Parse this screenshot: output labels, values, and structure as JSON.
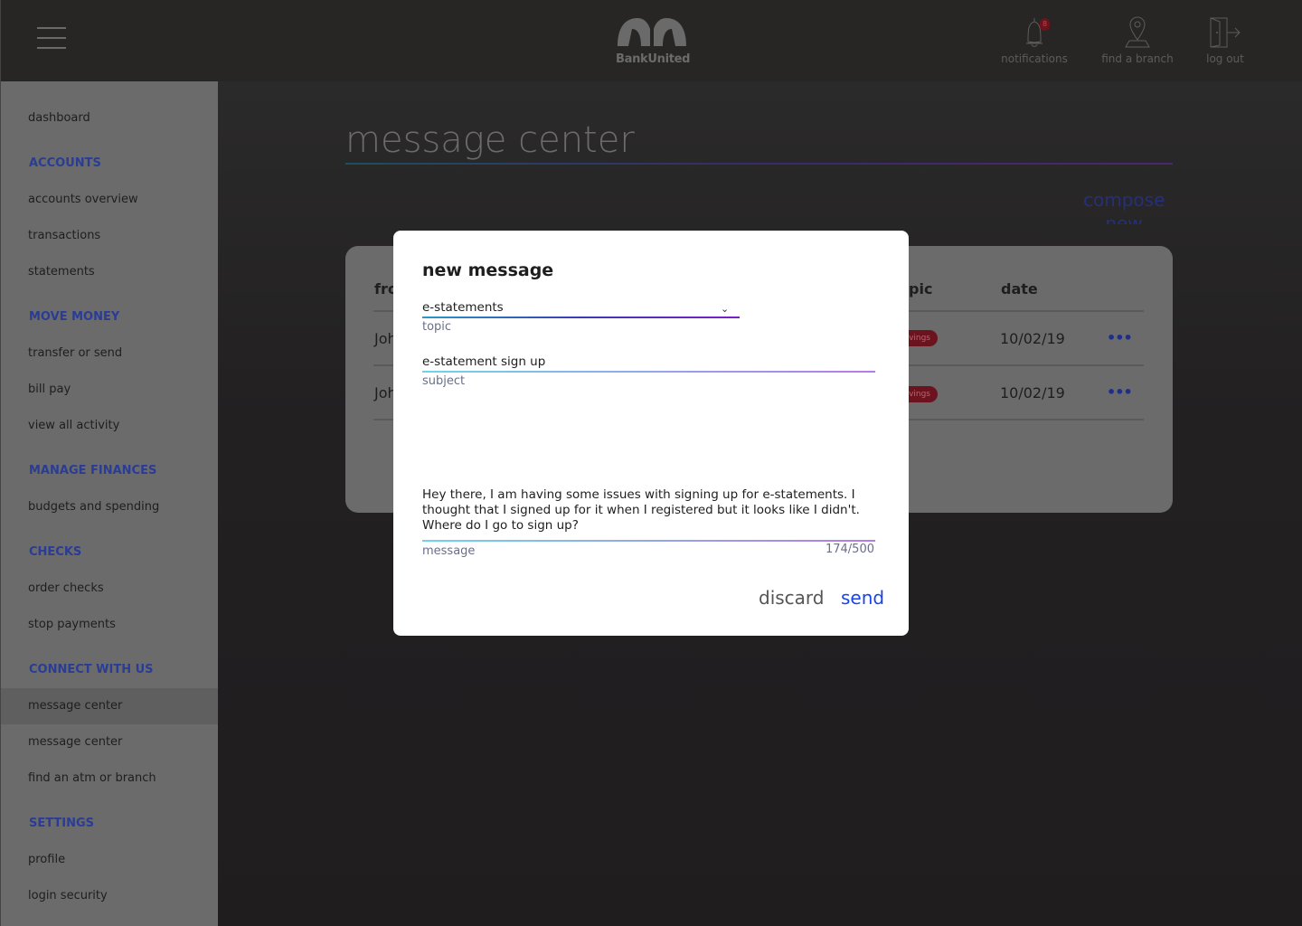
{
  "header": {
    "brand": "BankUnited",
    "nav": [
      {
        "label": "notifications",
        "icon": "bell-icon",
        "badge": "8"
      },
      {
        "label": "find a branch",
        "icon": "map-pin-icon"
      },
      {
        "label": "log out",
        "icon": "door-exit-icon"
      }
    ]
  },
  "sidebar": {
    "items": [
      {
        "type": "item",
        "label": "dashboard"
      },
      {
        "type": "head",
        "label": "ACCOUNTS"
      },
      {
        "type": "item",
        "label": "accounts overview"
      },
      {
        "type": "item",
        "label": "transactions"
      },
      {
        "type": "item",
        "label": "statements"
      },
      {
        "type": "head",
        "label": "MOVE MONEY"
      },
      {
        "type": "item",
        "label": "transfer or send"
      },
      {
        "type": "item",
        "label": "bill pay"
      },
      {
        "type": "item",
        "label": "view all activity"
      },
      {
        "type": "head",
        "label": "MANAGE FINANCES"
      },
      {
        "type": "item",
        "label": "budgets and spending"
      },
      {
        "type": "head",
        "label": "CHECKS"
      },
      {
        "type": "item",
        "label": "order checks"
      },
      {
        "type": "item",
        "label": "stop payments"
      },
      {
        "type": "head",
        "label": "CONNECT WITH US"
      },
      {
        "type": "item",
        "label": "message center",
        "active": true
      },
      {
        "type": "item",
        "label": "message center"
      },
      {
        "type": "item",
        "label": "find an atm or branch"
      },
      {
        "type": "head",
        "label": "SETTINGS"
      },
      {
        "type": "item",
        "label": "profile"
      },
      {
        "type": "item",
        "label": "login security"
      }
    ]
  },
  "main": {
    "title": "message center",
    "compose": "compose new",
    "table": {
      "headers": [
        "fro",
        "pic",
        "date"
      ],
      "rows": [
        {
          "from": "Joh",
          "topic": "vings",
          "date": "10/02/19"
        },
        {
          "from": "Joh",
          "topic": "vings",
          "date": "10/02/19"
        }
      ]
    }
  },
  "modal": {
    "title": "new message",
    "topic_value": "e-statements",
    "topic_label": "topic",
    "subject_value": "e-statement sign up",
    "subject_label": "subject",
    "message_value": "Hey there, I am having some issues with signing up for e-statements. I thought that I signed up for it when I registered but it looks like I didn't. Where do I go to sign up?",
    "message_label": "message",
    "count": "174/500",
    "discard": "discard",
    "send": "send"
  },
  "colors": {
    "accent": "#1a44e8",
    "heading": "#2a3c94",
    "gradient_start": "#6fd3ee",
    "gradient_end": "#b77ae8"
  }
}
